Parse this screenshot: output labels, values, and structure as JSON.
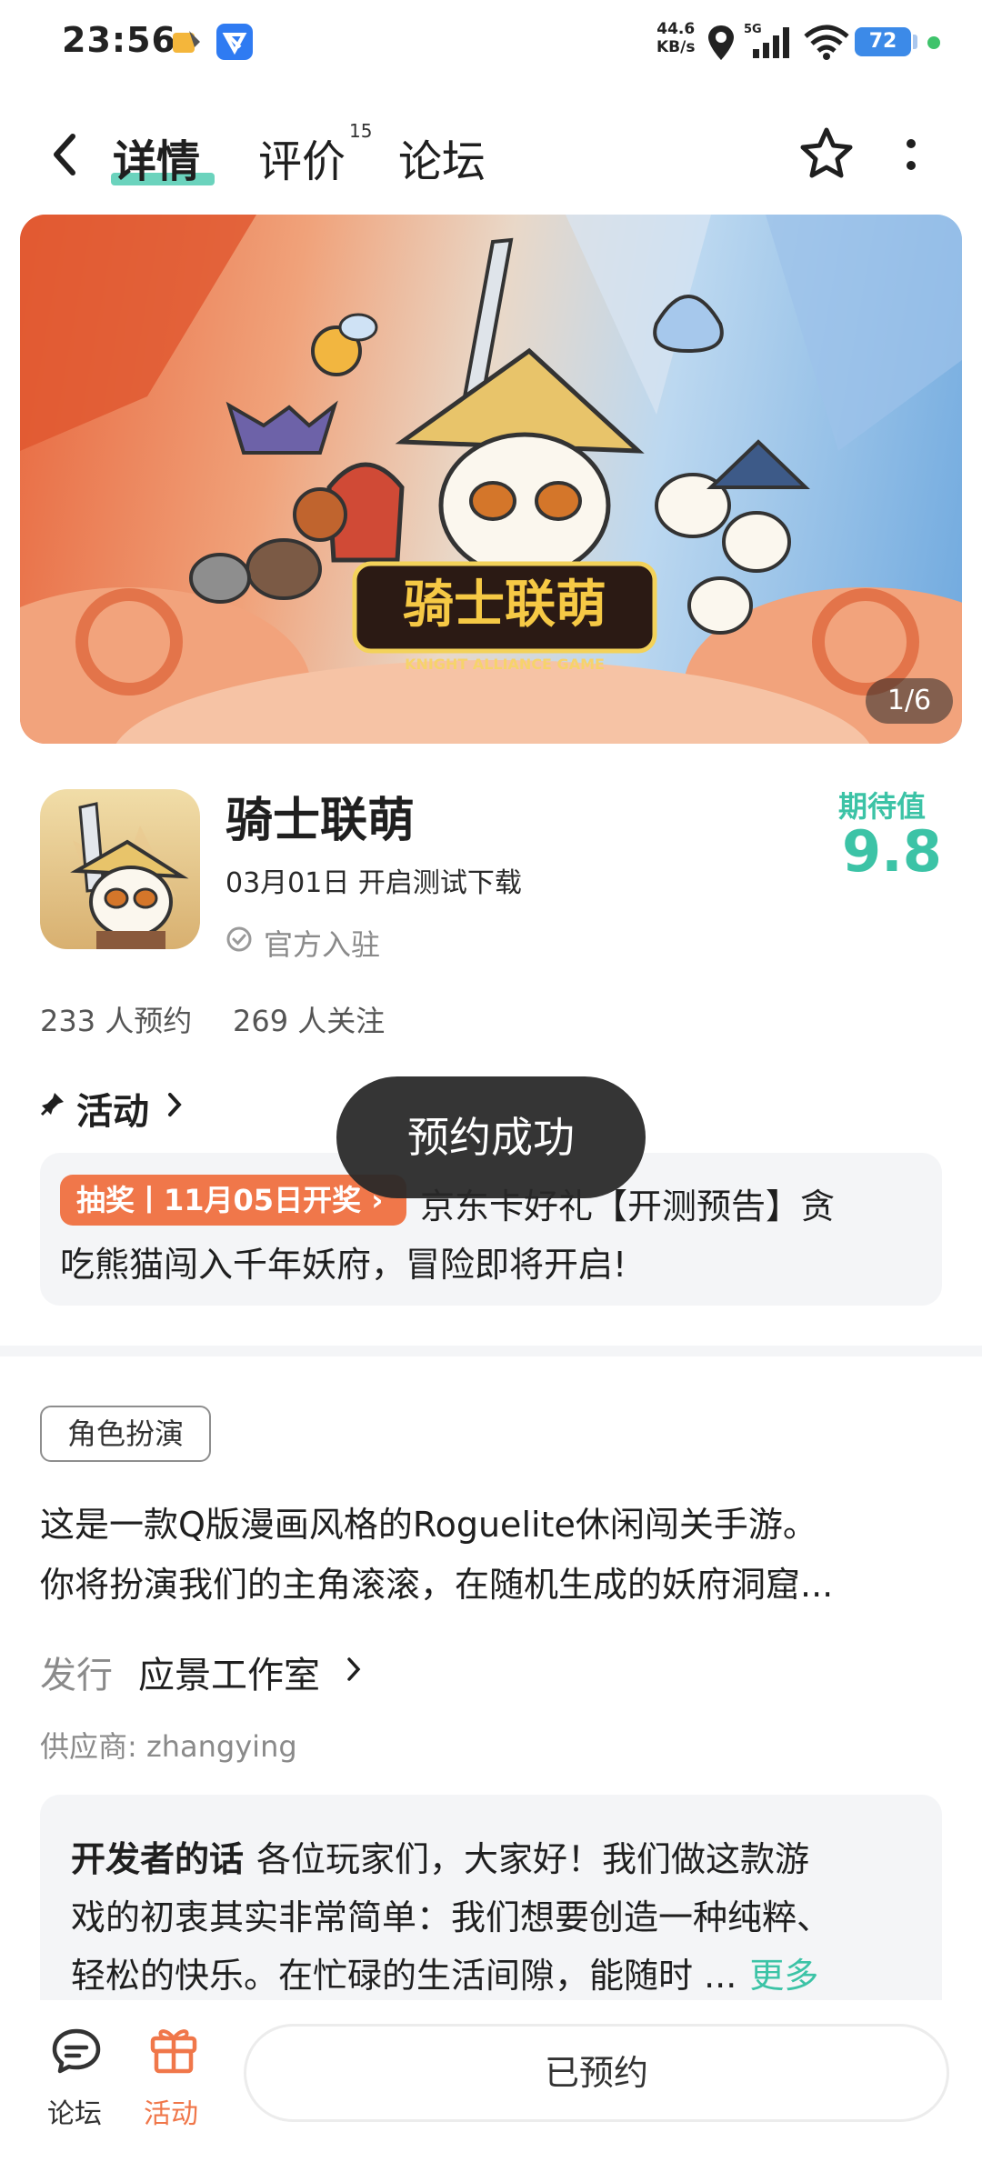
{
  "status_bar": {
    "time": "23:56",
    "net_speed_value": "44.6",
    "net_speed_unit": "KB/s",
    "network": "5G",
    "battery": "72",
    "icons": [
      "weather-icon",
      "app-notification-icon",
      "location-icon",
      "signal-icon",
      "wifi-icon",
      "battery-icon"
    ]
  },
  "nav": {
    "tabs": [
      {
        "label": "详情",
        "active": true
      },
      {
        "label": "评价",
        "count": "15"
      },
      {
        "label": "论坛"
      }
    ],
    "icons": [
      "back-icon",
      "star-icon",
      "more-icon"
    ]
  },
  "banner": {
    "logo_title": "骑士联萌",
    "logo_subtitle": "KNIGHT ALLIANCE GAME",
    "counter": "1/6"
  },
  "game": {
    "name": "骑士联萌",
    "release": "03月01日 开启测试下载",
    "official": "官方入驻",
    "expect_label": "期待值",
    "expect_score": "9.8",
    "reserve_count": "233 人预约",
    "follow_count": "269 人关注"
  },
  "activity": {
    "title": "活动",
    "badge": "抽奖丨11月05日开奖",
    "line1": "京东卡好礼【开测预告】贪",
    "line2": "吃熊猫闯入千年妖府，冒险即将开启!"
  },
  "toast": "预约成功",
  "description": {
    "genre": "角色扮演",
    "line1": "这是一款Q版漫画风格的Roguelite休闲闯关手游。",
    "line2": "你将扮演我们的主角滚滚，在随机生成的妖府洞窟...",
    "publisher_label": "发行",
    "publisher_name": "应景工作室",
    "supplier": "供应商: zhangying"
  },
  "developer": {
    "label": "开发者的话",
    "line1": "各位玩家们，大家好！我们做这款游",
    "line2": "戏的初衷其实非常简单：我们想要创造一种纯粹、",
    "line3": "轻松的快乐。在忙碌的生活间隙，能随时 ...",
    "more": "更多"
  },
  "bottom_bar": {
    "forum_label": "论坛",
    "activity_label": "活动",
    "reserved_label": "已预约"
  },
  "colors": {
    "accent": "#3cc3a6",
    "orange": "#f0774a",
    "toast_bg": "#282828"
  }
}
